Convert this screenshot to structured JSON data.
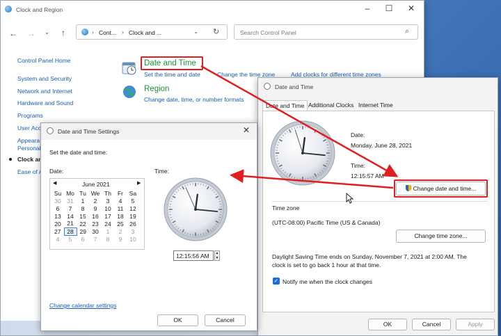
{
  "control_panel": {
    "title": "Clock and Region",
    "breadcrumb": [
      "Cont...",
      "Clock and ..."
    ],
    "search_placeholder": "Search Control Panel",
    "sidebar": [
      "Control Panel Home",
      "System and Security",
      "Network and Internet",
      "Hardware and Sound",
      "Programs",
      "User Acc",
      "Appeara",
      "Personal",
      "Clock an",
      "Ease of A"
    ],
    "date_time_heading": "Date and Time",
    "date_time_links": [
      "Set the time and date",
      "Change the time zone",
      "Add clocks for different time zones"
    ],
    "region_heading": "Region",
    "region_link": "Change date, time, or number formats"
  },
  "settings": {
    "title": "Date and Time Settings",
    "prompt": "Set the date and time:",
    "date_label": "Date:",
    "time_label": "Time:",
    "month": "June 2021",
    "weekdays": [
      "Su",
      "Mo",
      "Tu",
      "We",
      "Th",
      "Fr",
      "Sa"
    ],
    "weeks": [
      [
        "30",
        "31",
        "1",
        "2",
        "3",
        "4",
        "5"
      ],
      [
        "6",
        "7",
        "8",
        "9",
        "10",
        "11",
        "12"
      ],
      [
        "13",
        "14",
        "15",
        "16",
        "17",
        "18",
        "19"
      ],
      [
        "20",
        "21",
        "22",
        "23",
        "24",
        "25",
        "26"
      ],
      [
        "27",
        "28",
        "29",
        "30",
        "1",
        "2",
        "3"
      ],
      [
        "4",
        "5",
        "6",
        "7",
        "8",
        "9",
        "10"
      ]
    ],
    "selected_day": "28",
    "time_value": "12:15:56 AM",
    "calendar_link": "Change calendar settings",
    "ok": "OK",
    "cancel": "Cancel",
    "clock": {
      "hour": 0,
      "minute": 15,
      "second": 56
    }
  },
  "date_time": {
    "title": "Date and Time",
    "tabs": [
      "Date and Time",
      "Additional Clocks",
      "Internet Time"
    ],
    "date_label": "Date:",
    "date_value": "Monday, June 28, 2021",
    "time_label": "Time:",
    "time_value": "12:15:57 AM",
    "change_datetime": "Change date and time...",
    "time_zone_label": "Time zone",
    "time_zone_value": "(UTC-08:00) Pacific Time (US & Canada)",
    "change_zone": "Change time zone...",
    "dst_line1": "Daylight Saving Time ends on Sunday, November 7, 2021 at 2:00 AM. The",
    "dst_line2": "clock is set to go back 1 hour at that time.",
    "notify": "Notify me when the clock changes",
    "ok": "OK",
    "cancel": "Cancel",
    "apply": "Apply",
    "clock": {
      "hour": 0,
      "minute": 15,
      "second": 57
    }
  },
  "colors": {
    "accent": "#1a5fb4",
    "annotation": "#e02020",
    "heading_green": "#1f8f3a"
  }
}
